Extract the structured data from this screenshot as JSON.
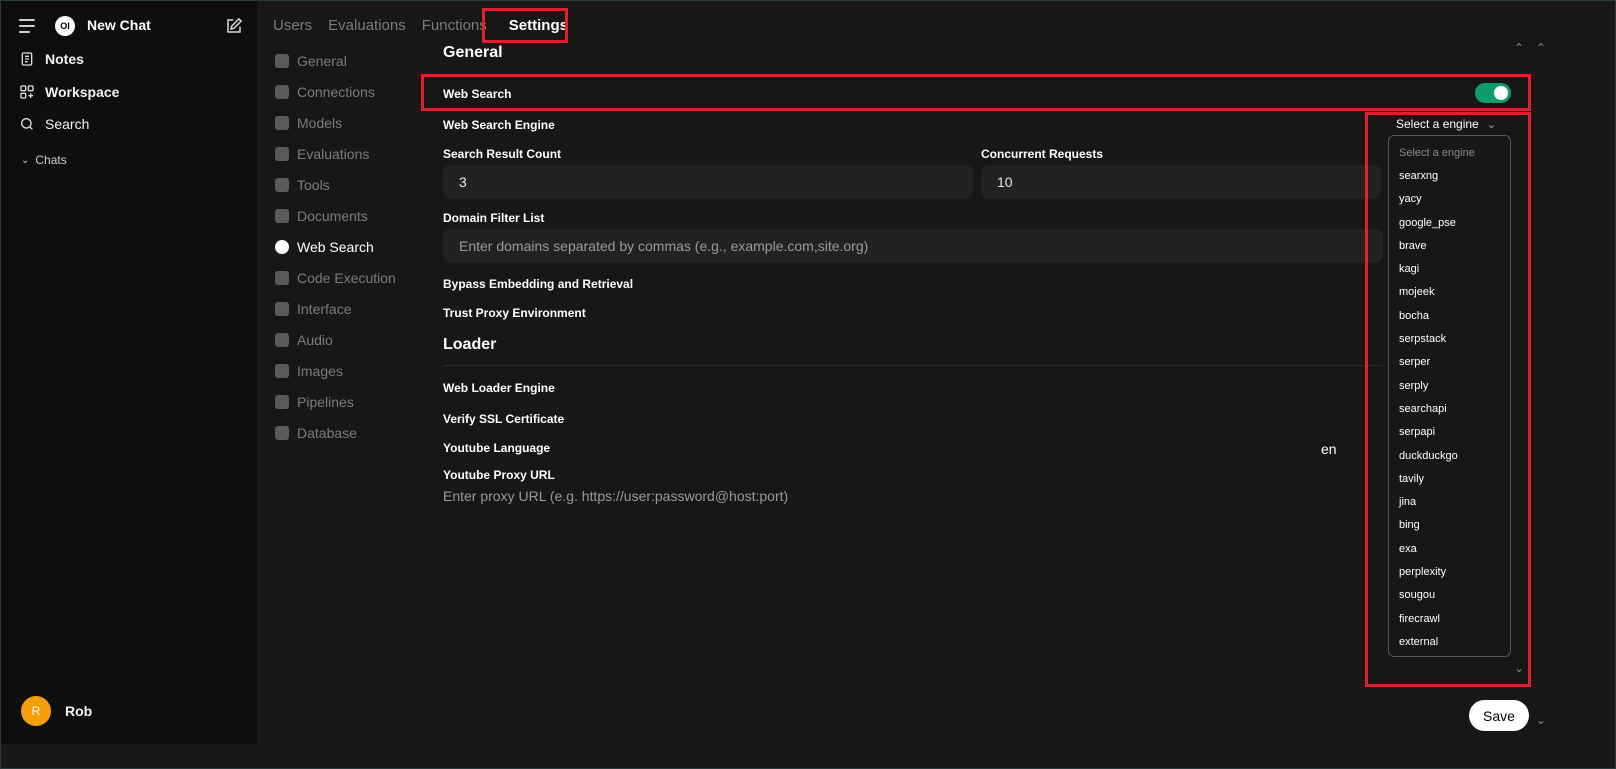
{
  "sidebar": {
    "new_chat": "New Chat",
    "logo_text": "OI",
    "items": [
      {
        "label": "Notes"
      },
      {
        "label": "Workspace"
      },
      {
        "label": "Search"
      }
    ],
    "chats_label": "Chats",
    "user": {
      "initial": "R",
      "name": "Rob"
    }
  },
  "tabs": [
    "Users",
    "Evaluations",
    "Functions",
    "Settings"
  ],
  "settings_nav": [
    "General",
    "Connections",
    "Models",
    "Evaluations",
    "Tools",
    "Documents",
    "Web Search",
    "Code Execution",
    "Interface",
    "Audio",
    "Images",
    "Pipelines",
    "Database"
  ],
  "settings_nav_active": "Web Search",
  "general": {
    "heading": "General",
    "web_search_label": "Web Search",
    "web_search_enabled": true,
    "engine_label": "Web Search Engine",
    "result_count_label": "Search Result Count",
    "result_count_value": "3",
    "concurrent_label": "Concurrent Requests",
    "concurrent_value": "10",
    "domain_filter_label": "Domain Filter List",
    "domain_filter_placeholder": "Enter domains separated by commas (e.g., example.com,site.org)",
    "bypass_label": "Bypass Embedding and Retrieval",
    "trust_proxy_label": "Trust Proxy Environment"
  },
  "loader": {
    "heading": "Loader",
    "engine_label": "Web Loader Engine",
    "ssl_label": "Verify SSL Certificate",
    "yt_lang_label": "Youtube Language",
    "yt_lang_value": "en",
    "yt_proxy_label": "Youtube Proxy URL",
    "yt_proxy_placeholder": "Enter proxy URL (e.g. https://user:password@host:port)"
  },
  "engine_dropdown": {
    "selected": "Select a engine",
    "options": [
      "Select a engine",
      "searxng",
      "yacy",
      "google_pse",
      "brave",
      "kagi",
      "mojeek",
      "bocha",
      "serpstack",
      "serper",
      "serply",
      "searchapi",
      "serpapi",
      "duckduckgo",
      "tavily",
      "jina",
      "bing",
      "exa",
      "perplexity",
      "sougou",
      "firecrawl",
      "external"
    ]
  },
  "save_label": "Save",
  "colors": {
    "toggle_on": "#0f9d6b",
    "highlight": "#e0202e",
    "avatar": "#f59e0b"
  }
}
